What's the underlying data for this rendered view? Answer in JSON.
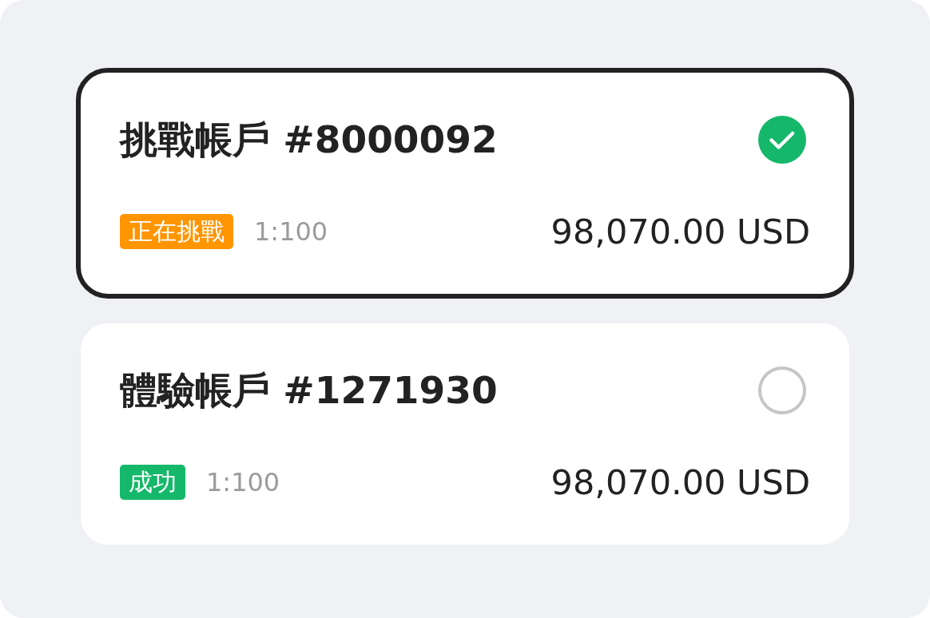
{
  "accounts": [
    {
      "title": "挑戰帳戶 #8000092",
      "selected": true,
      "status": {
        "label": "正在挑戰",
        "color": "#ff9500"
      },
      "leverage": "1:100",
      "balance": "98,070.00 USD"
    },
    {
      "title": "體驗帳戶 #1271930",
      "selected": false,
      "status": {
        "label": "成功",
        "color": "#15b86a"
      },
      "leverage": "1:100",
      "balance": "98,070.00 USD"
    }
  ]
}
